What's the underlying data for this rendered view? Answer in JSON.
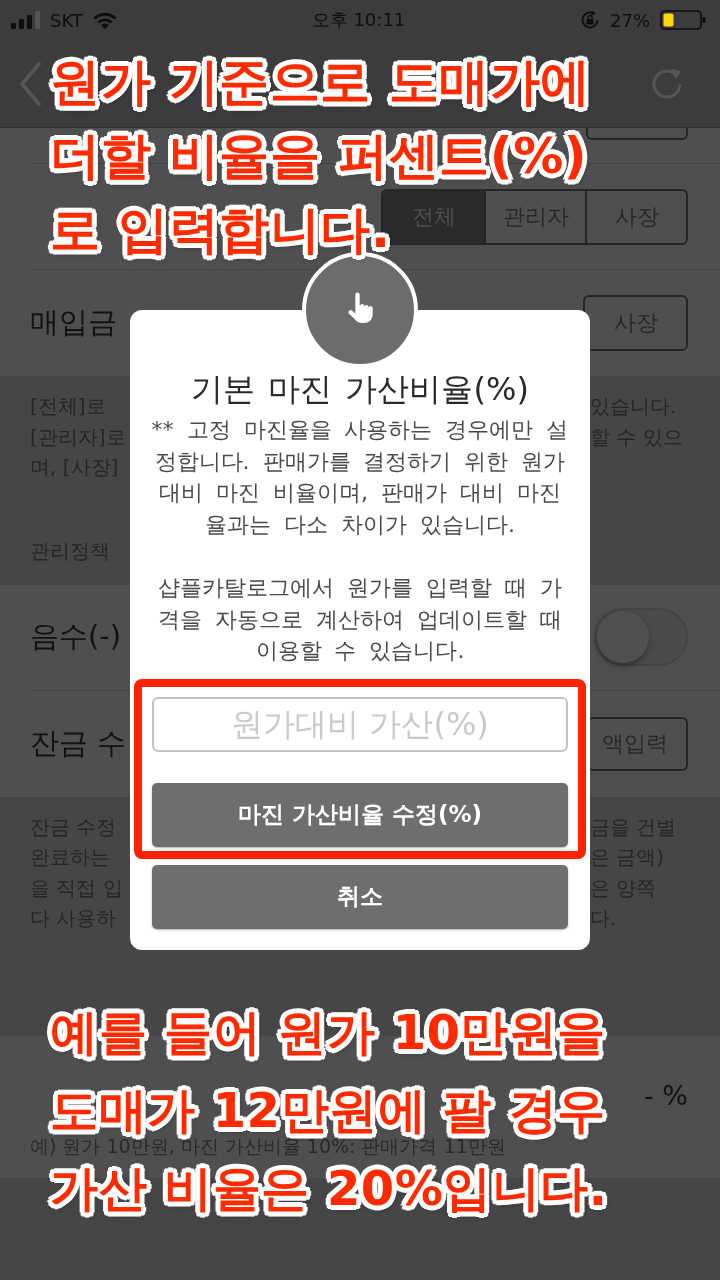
{
  "status_bar": {
    "carrier": "SKT",
    "time": "오후 10:11",
    "battery": "27%"
  },
  "content": [
    {
      "kind": "field-stub"
    },
    {
      "kind": "segmented",
      "options": [
        {
          "label": "전체",
          "selected": true
        },
        {
          "label": "관리자",
          "selected": false
        },
        {
          "label": "사장",
          "selected": false
        }
      ]
    },
    {
      "kind": "segmented",
      "label": "매입금",
      "options": [
        {
          "label": "사장",
          "selected": false
        }
      ]
    },
    {
      "kind": "note",
      "left": [
        "[전체]로",
        "[관리자]로",
        "며, [사장]"
      ],
      "right": [
        "있습니다.",
        "할 수 있으"
      ]
    },
    {
      "kind": "header",
      "label": "관리정책"
    },
    {
      "kind": "toggle",
      "label": "음수(-)",
      "on": false
    },
    {
      "kind": "button",
      "label": "잔금 수",
      "button": "액입력"
    },
    {
      "kind": "note",
      "left": [
        "잔금 수정",
        "완료하는",
        "을 직접 입",
        "다 사용하"
      ],
      "right": [
        "금을 건별",
        "은 금액)",
        "은 양쪽",
        "다."
      ]
    },
    {
      "kind": "header"
    },
    {
      "kind": "value",
      "value": "- %",
      "caption": "예) 원가 10만원, 마진 가산비율 10%: 판매가격 11만원"
    }
  ],
  "dialog": {
    "title": "기본 마진 가산비율(%)",
    "paragraphs": [
      "** 고정 마진율을 사용하는 경우에만 설정합니다. 판매가를 결정하기 위한 원가 대비 마진 비율이며, 판매가 대비 마진율과는 다소 차이가 있습니다.",
      "샵플카탈로그에서 원가를 입력할 때 가격을 자동으로 계산하여 업데이트할 때 이용할 수 있습니다."
    ],
    "controls": [
      {
        "kind": "input",
        "placeholder": "원가대비 가산(%)",
        "highlighted": true
      },
      {
        "kind": "button",
        "label": "마진 가산비율 수정(%)",
        "highlighted": true
      },
      {
        "kind": "button",
        "label": "취소",
        "highlighted": false
      }
    ]
  },
  "annotations": [
    {
      "lines": [
        "원가 기준으로 도매가에",
        "더할 비율을 퍼센트(%)",
        "로 입력합니다."
      ]
    },
    {
      "lines": [
        "예를 들어 원가 10만원을",
        "도매가 12만원에 팔 경우",
        "가산 비율은 20%입니다."
      ]
    }
  ]
}
